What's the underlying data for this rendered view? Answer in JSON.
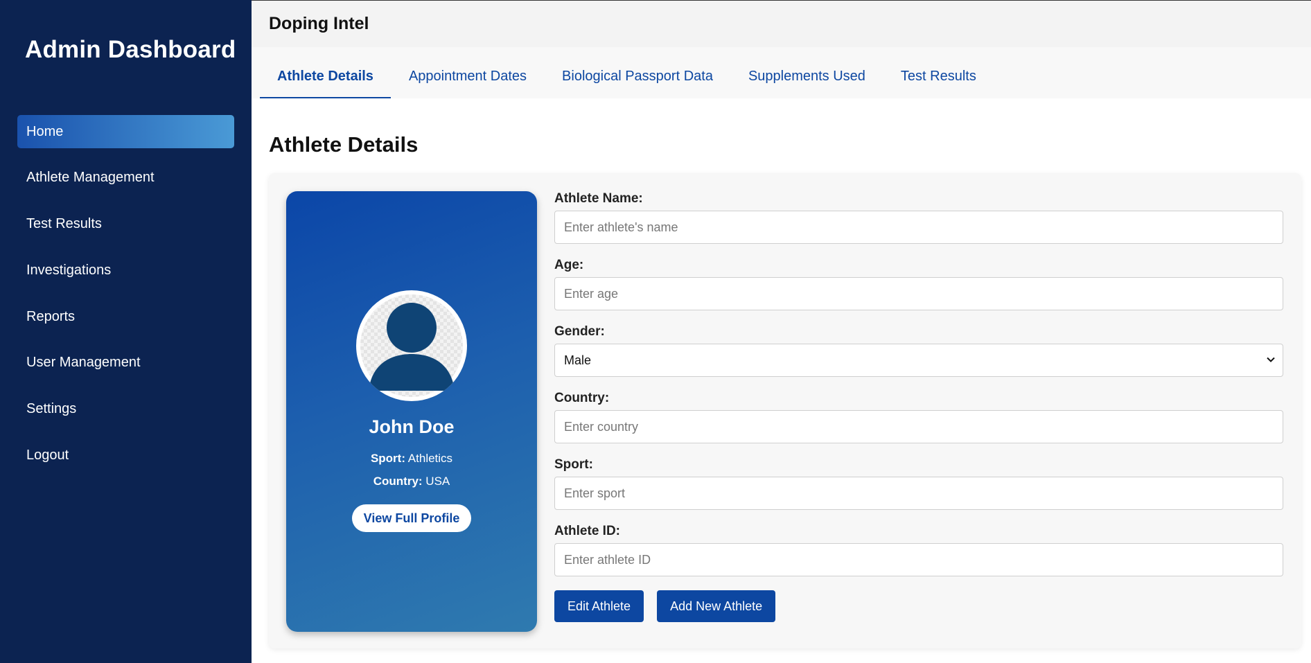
{
  "sidebar": {
    "title": "Admin Dashboard",
    "items": [
      {
        "label": "Home",
        "active": true
      },
      {
        "label": "Athlete Management"
      },
      {
        "label": "Test Results"
      },
      {
        "label": "Investigations"
      },
      {
        "label": "Reports"
      },
      {
        "label": "User Management"
      },
      {
        "label": "Settings"
      },
      {
        "label": "Logout"
      }
    ]
  },
  "header": {
    "title": "Doping Intel"
  },
  "tabs": [
    {
      "label": "Athlete Details",
      "active": true
    },
    {
      "label": "Appointment Dates"
    },
    {
      "label": "Biological Passport Data"
    },
    {
      "label": "Supplements Used"
    },
    {
      "label": "Test Results"
    }
  ],
  "page": {
    "title": "Athlete Details"
  },
  "profile": {
    "name": "John Doe",
    "sport_label": "Sport:",
    "sport": "Athletics",
    "country_label": "Country:",
    "country": "USA",
    "button": "View Full Profile",
    "avatar_icon": "user-avatar-icon"
  },
  "form": {
    "name": {
      "label": "Athlete Name:",
      "placeholder": "Enter athlete's name",
      "value": ""
    },
    "age": {
      "label": "Age:",
      "placeholder": "Enter age",
      "value": ""
    },
    "gender": {
      "label": "Gender:",
      "value": "Male"
    },
    "country": {
      "label": "Country:",
      "placeholder": "Enter country",
      "value": ""
    },
    "sport": {
      "label": "Sport:",
      "placeholder": "Enter sport",
      "value": ""
    },
    "athlete_id": {
      "label": "Athlete ID:",
      "placeholder": "Enter athlete ID",
      "value": ""
    },
    "edit_button": "Edit Athlete",
    "add_button": "Add New Athlete"
  },
  "colors": {
    "sidebar_bg": "#0c2351",
    "accent": "#0d47a1",
    "active_item_start": "#1a52ad",
    "active_item_end": "#4a9ad6"
  }
}
